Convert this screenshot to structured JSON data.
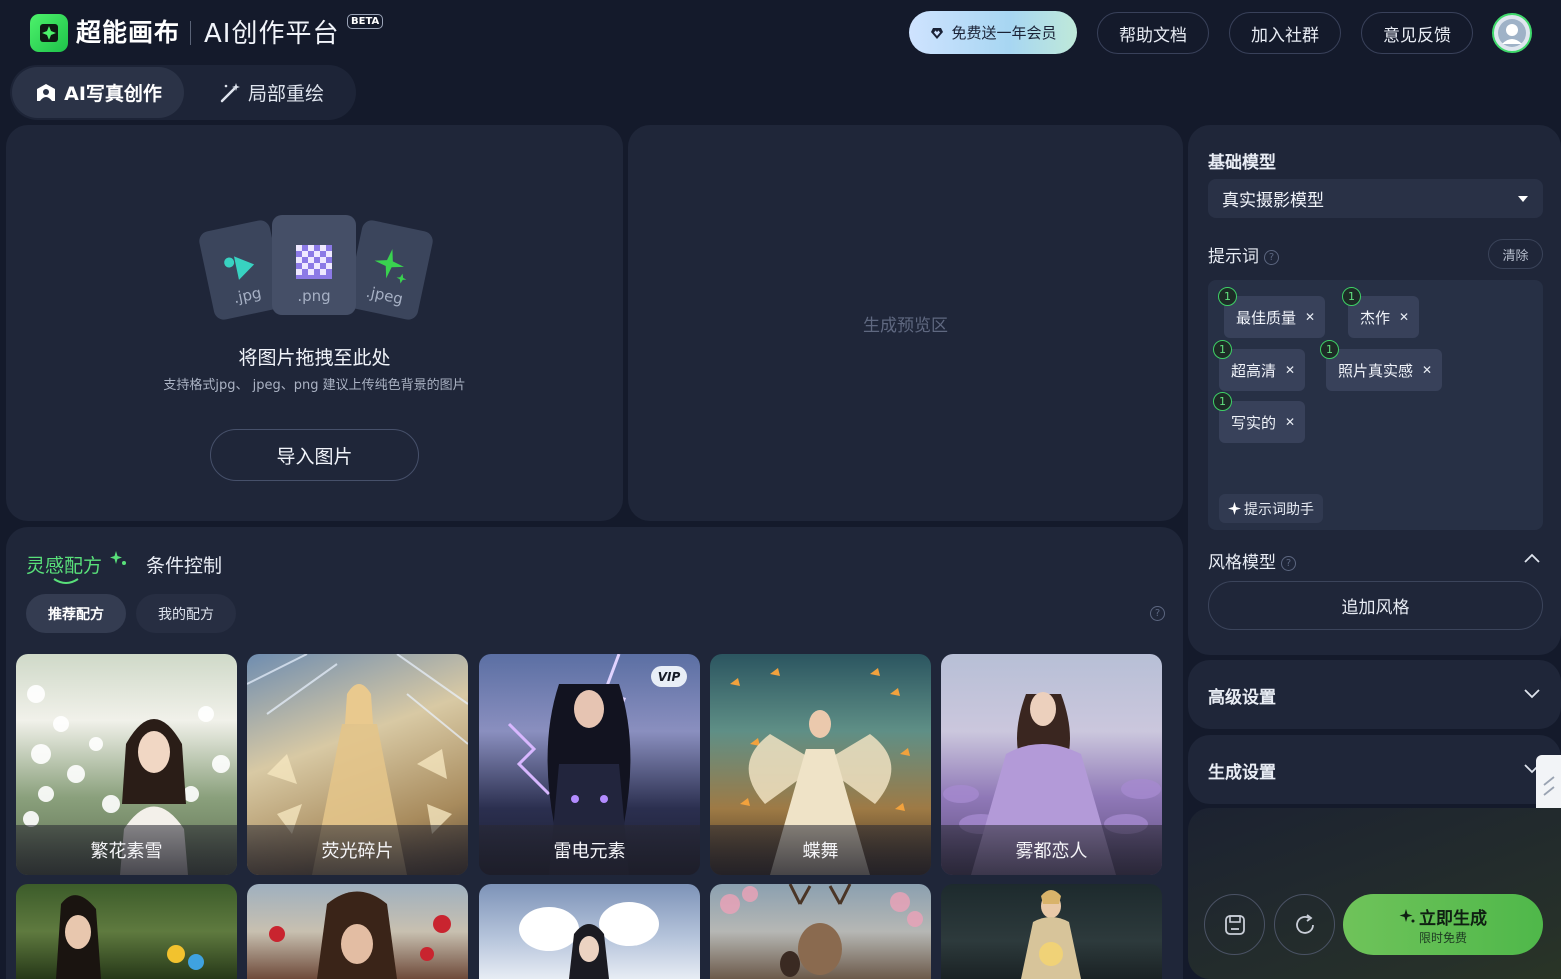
{
  "header": {
    "brand": "超能画布",
    "platform": "AI创作平台",
    "beta": "BETA",
    "vip_button": "免费送一年会员",
    "nav": [
      "帮助文档",
      "加入社群",
      "意见反馈"
    ]
  },
  "mode_tabs": {
    "active": "AI写真创作",
    "other": "局部重绘"
  },
  "upload": {
    "formats": [
      ".jpg",
      ".png",
      ".jpeg"
    ],
    "title": "将图片拖拽至此处",
    "subtitle": "支持格式jpg、 jpeg、png 建议上传纯色背景的图片",
    "import_button": "导入图片"
  },
  "preview": {
    "placeholder": "生成预览区"
  },
  "settings": {
    "base_model_label": "基础模型",
    "base_model_value": "真实摄影模型",
    "prompt_label": "提示词",
    "clear_button": "清除",
    "prompt_tags": [
      {
        "label": "最佳质量",
        "weight": "1"
      },
      {
        "label": "杰作",
        "weight": "1"
      },
      {
        "label": "超高清",
        "weight": "1"
      },
      {
        "label": "照片真实感",
        "weight": "1"
      },
      {
        "label": "写实的",
        "weight": "1"
      }
    ],
    "prompt_assistant": "提示词助手",
    "style_model_label": "风格模型",
    "add_style": "追加风格",
    "advanced_label": "高级设置",
    "generate_settings_label": "生成设置"
  },
  "actions": {
    "generate_main": "立即生成",
    "generate_sub": "限时免费"
  },
  "inspiration": {
    "tabs": [
      "灵感配方",
      "条件控制"
    ],
    "pills": [
      "推荐配方",
      "我的配方"
    ],
    "cards_row1": [
      {
        "label": "繁花素雪",
        "vip": false
      },
      {
        "label": "荧光碎片",
        "vip": false
      },
      {
        "label": "雷电元素",
        "vip": true
      },
      {
        "label": "蝶舞",
        "vip": false
      },
      {
        "label": "雾都恋人",
        "vip": false
      }
    ],
    "vip_badge": "VIP"
  }
}
